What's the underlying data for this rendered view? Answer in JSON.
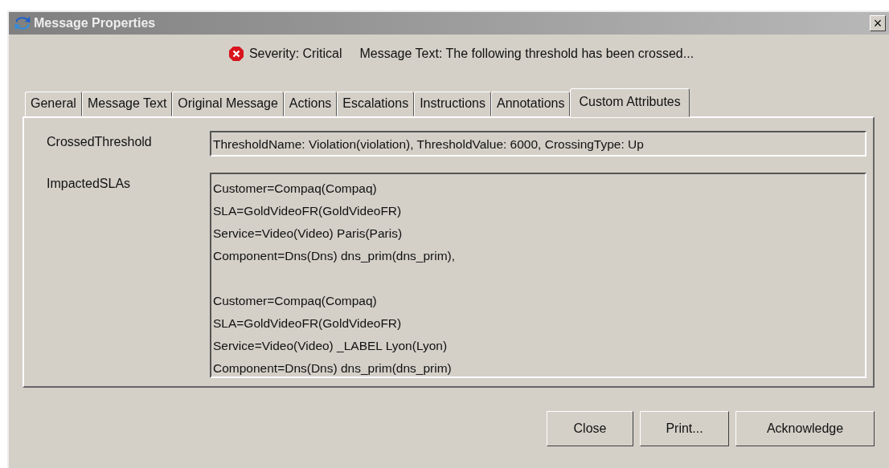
{
  "window": {
    "title": "Message Properties",
    "close": "×"
  },
  "header": {
    "severity": "Severity: Critical",
    "message_text": "Message Text: The following threshold has been crossed..."
  },
  "tabs": [
    {
      "label": "General",
      "selected": false
    },
    {
      "label": "Message Text",
      "selected": false
    },
    {
      "label": "Original Message",
      "selected": false
    },
    {
      "label": "Actions",
      "selected": false
    },
    {
      "label": "Escalations",
      "selected": false
    },
    {
      "label": "Instructions",
      "selected": false
    },
    {
      "label": "Annotations",
      "selected": false
    },
    {
      "label": "Custom Attributes",
      "selected": true
    }
  ],
  "attributes": [
    {
      "label": "CrossedThreshold",
      "kind": "line",
      "value": "ThresholdName: Violation(violation), ThresholdValue: 6000, CrossingType: Up"
    },
    {
      "label": "ImpactedSLAs",
      "kind": "area",
      "blocks": [
        [
          "Customer=Compaq(Compaq)",
          "SLA=GoldVideoFR(GoldVideoFR)",
          "Service=Video(Video) Paris(Paris)",
          "Component=Dns(Dns) dns_prim(dns_prim),"
        ],
        [
          "Customer=Compaq(Compaq)",
          "SLA=GoldVideoFR(GoldVideoFR)",
          "Service=Video(Video) _LABEL Lyon(Lyon)",
          "Component=Dns(Dns) dns_prim(dns_prim)"
        ]
      ]
    }
  ],
  "buttons": [
    "Close",
    "Print...",
    "Acknowledge"
  ]
}
